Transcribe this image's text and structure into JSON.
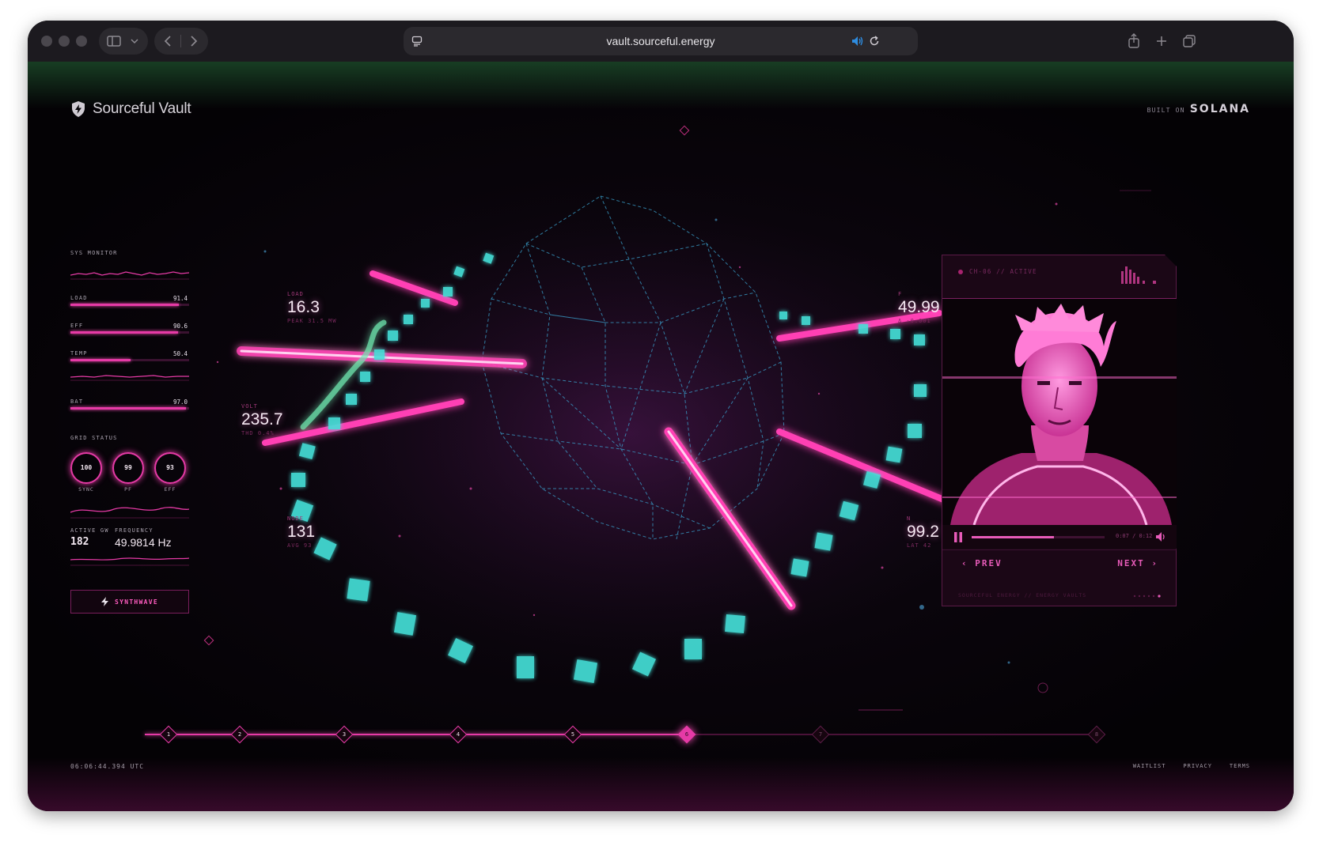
{
  "browser": {
    "url": "vault.sourceful.energy"
  },
  "header": {
    "brand": "Sourceful Vault",
    "built_on_prefix": "BUILT ON",
    "built_on_name": "SOLANA"
  },
  "sys_monitor": {
    "title": "SYS MONITOR",
    "metrics": [
      {
        "label": "LOAD",
        "value": "91.4",
        "level": 0.914
      },
      {
        "label": "EFF",
        "value": "90.6",
        "level": 0.906
      },
      {
        "label": "TEMP",
        "value": "50.4",
        "level": 0.504
      },
      {
        "label": "BAT",
        "value": "97.0",
        "level": 0.97
      }
    ]
  },
  "grid_status": {
    "title": "GRID STATUS",
    "gauges": [
      {
        "value": "100",
        "label": "SYNC"
      },
      {
        "value": "99",
        "label": "PF"
      },
      {
        "value": "93",
        "label": "EFF"
      }
    ],
    "active_gw_label": "ACTIVE GW",
    "active_gw_value": "182",
    "frequency_label": "FREQUENCY",
    "frequency_value": "49.9814 Hz"
  },
  "synthwave_button": "SYNTHWAVE",
  "stats": {
    "load": {
      "label": "LOAD",
      "value": "16.3",
      "sub": "PEAK 31.5 MW"
    },
    "volt": {
      "label": "VOLT",
      "value": "235.7",
      "sub": "THD 0.4%"
    },
    "node": {
      "label": "NODE",
      "value": "131",
      "sub": "AVG 93"
    },
    "right_top": {
      "label": "F",
      "value": "49.99",
      "sub": "Δ -0.001"
    },
    "right_bottom": {
      "label": "N",
      "value": "99.2",
      "sub": "LAT 42"
    }
  },
  "channel_panel": {
    "header": "CH-06 // ACTIVE",
    "time": "0:07 / 0:12",
    "progress": 0.62,
    "prev_label": "PREV",
    "next_label": "NEXT",
    "footer": "SOURCEFUL ENERGY // ENERGY VAULTS"
  },
  "timeline": {
    "steps": [
      "1",
      "2",
      "3",
      "4",
      "5",
      "6",
      "7",
      "8"
    ],
    "active_step": 6
  },
  "footer": {
    "clock": "06:06:44.394 UTC",
    "links": [
      "WAITLIST",
      "PRIVACY",
      "TERMS"
    ]
  },
  "colors": {
    "accent": "#e63aa6",
    "cyan": "#4fd8e0",
    "background": "#050307"
  }
}
